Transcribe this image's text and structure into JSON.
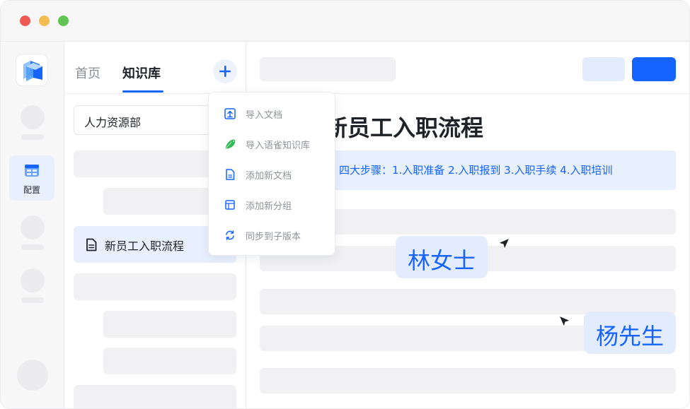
{
  "window": {
    "traffic_lights": [
      "#ec5a53",
      "#f4bd4f",
      "#61c554"
    ]
  },
  "rail": {
    "logo_icon": "app-logo-cube-icon",
    "config_icon": "config-grid-icon",
    "config_label": "配置"
  },
  "kb_panel": {
    "tabs": [
      {
        "label": "首页",
        "active": false
      },
      {
        "label": "知识库",
        "active": true
      }
    ],
    "add_icon": "plus-icon",
    "department": "人力资源部",
    "doc_item_icon": "document-icon",
    "selected_doc": "新员工入职流程"
  },
  "add_menu": {
    "items": [
      {
        "label": "导入文档",
        "icon": "upload-icon"
      },
      {
        "label": "导入语雀知识库",
        "icon": "yuque-bird-icon"
      },
      {
        "label": "添加新文档",
        "icon": "new-document-icon"
      },
      {
        "label": "添加新分组",
        "icon": "group-icon"
      },
      {
        "label": "同步到子版本",
        "icon": "sync-icon"
      }
    ]
  },
  "document": {
    "title": "新员工入职流程",
    "summary": "四大步骤：1.入职准备 2.入职报到 3.入职手续 4.入职培训"
  },
  "collaborators": [
    {
      "name": "林女士",
      "cursor_icon": "cursor-arrow-icon"
    },
    {
      "name": "杨先生",
      "cursor_icon": "cursor-arrow-icon"
    }
  ],
  "colors": {
    "accent": "#1664ff",
    "accent_light": "#e8effd"
  }
}
